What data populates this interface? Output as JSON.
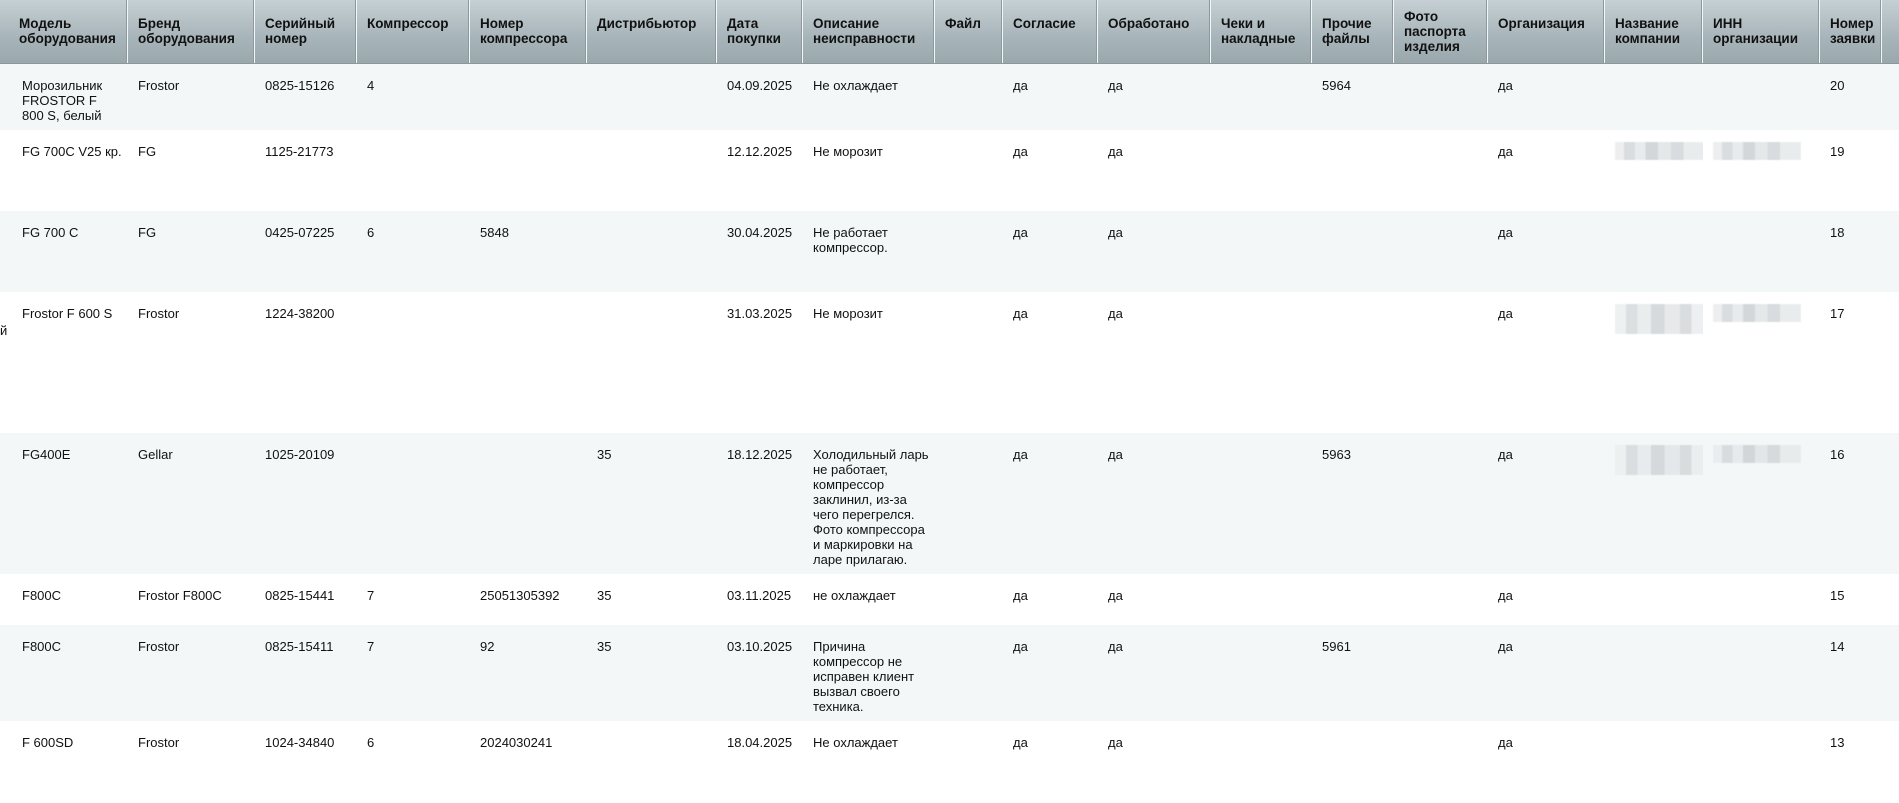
{
  "table": {
    "columns": [
      "Модель оборудования",
      "Бренд оборудования",
      "Серийный номер",
      "Компрессор",
      "Номер компрессора",
      "Дистрибьютор",
      "Дата покупки",
      "Описание неисправности",
      "Файл",
      "Согласие",
      "Обработано",
      "Чеки и накладные",
      "Прочие файлы",
      "Фото паспорта изделия",
      "Организация",
      "Название компании",
      "ИНН организации",
      "Номер заявки"
    ],
    "rows": [
      {
        "model": "Морозильник FROSTOR F 800 S, белый",
        "brand": "Frostor",
        "serial": "0825-15126",
        "compressor": "4",
        "compressor_number": "",
        "distributor": "",
        "purchase_date": "04.09.2025",
        "fault": "Не охлаждает",
        "file": "",
        "consent": "да",
        "processed": "да",
        "receipts": "",
        "other_files": "5964",
        "passport_photo": "",
        "organization": "да",
        "company_name": "",
        "inn": "",
        "request_number": "20",
        "redacted": false
      },
      {
        "model": "FG 700C V25 кр.",
        "brand": "FG",
        "serial": "1125-21773",
        "compressor": "",
        "compressor_number": "",
        "distributor": "",
        "purchase_date": "12.12.2025",
        "fault": "Не морозит",
        "file": "",
        "consent": "да",
        "processed": "да",
        "receipts": "",
        "other_files": "",
        "passport_photo": "",
        "organization": "да",
        "company_name": "",
        "inn": "",
        "request_number": "19",
        "redacted": true
      },
      {
        "model": "FG 700 C",
        "brand": "FG",
        "serial": "0425-07225",
        "compressor": "6",
        "compressor_number": "5848",
        "distributor": "",
        "purchase_date": "30.04.2025",
        "fault": "Не работает компрессор.",
        "file": "",
        "consent": "да",
        "processed": "да",
        "receipts": "",
        "other_files": "",
        "passport_photo": "",
        "organization": "да",
        "company_name": "",
        "inn": "",
        "request_number": "18",
        "redacted": false
      },
      {
        "model": "Frostor F 600 S",
        "brand": "Frostor",
        "serial": "1224-38200",
        "compressor": "",
        "compressor_number": "",
        "distributor": "",
        "purchase_date": "31.03.2025",
        "fault": "Не морозит",
        "file": "",
        "consent": "да",
        "processed": "да",
        "receipts": "",
        "other_files": "",
        "passport_photo": "",
        "organization": "да",
        "company_name": "",
        "inn": "",
        "request_number": "17",
        "redacted": true
      },
      {
        "model": "FG400E",
        "brand": "Gellar",
        "serial": "1025-20109",
        "compressor": "",
        "compressor_number": "",
        "distributor": "35",
        "purchase_date": "18.12.2025",
        "fault": "Холодильный ларь не работает, компрессор заклинил, из-за чего перегрелся. Фото компрессора и маркировки на ларе прилагаю.",
        "file": "",
        "consent": "да",
        "processed": "да",
        "receipts": "",
        "other_files": "5963",
        "passport_photo": "",
        "organization": "да",
        "company_name": "",
        "inn": "",
        "request_number": "16",
        "redacted": true
      },
      {
        "model": "F800C",
        "brand": "Frostor F800C",
        "serial": "0825-15441",
        "compressor": "7",
        "compressor_number": "25051305392",
        "distributor": "35",
        "purchase_date": "03.11.2025",
        "fault": "не охлаждает",
        "file": "",
        "consent": "да",
        "processed": "да",
        "receipts": "",
        "other_files": "",
        "passport_photo": "",
        "organization": "да",
        "company_name": "",
        "inn": "",
        "request_number": "15",
        "redacted": false
      },
      {
        "model": "F800C",
        "brand": "Frostor",
        "serial": "0825-15411",
        "compressor": "7",
        "compressor_number": "92",
        "distributor": "35",
        "purchase_date": "03.10.2025",
        "fault": "Причина компрессор не исправен клиент вызвал своего техника.",
        "file": "",
        "consent": "да",
        "processed": "да",
        "receipts": "",
        "other_files": "5961",
        "passport_photo": "",
        "organization": "да",
        "company_name": "",
        "inn": "",
        "request_number": "14",
        "redacted": false
      },
      {
        "model": "F 600SD",
        "brand": "Frostor",
        "serial": "1024-34840",
        "compressor": "6",
        "compressor_number": "2024030241",
        "distributor": "",
        "purchase_date": "18.04.2025",
        "fault": "Не охлаждает",
        "file": "",
        "consent": "да",
        "processed": "да",
        "receipts": "",
        "other_files": "",
        "passport_photo": "",
        "organization": "да",
        "company_name": "",
        "inn": "",
        "request_number": "13",
        "redacted": false
      }
    ],
    "edge_glyph": "й",
    "colors": {
      "header_top": "#c6d0d4",
      "header_bottom": "#9aa8ad",
      "row_alt": "#f3f7f8",
      "row": "#ffffff"
    }
  }
}
